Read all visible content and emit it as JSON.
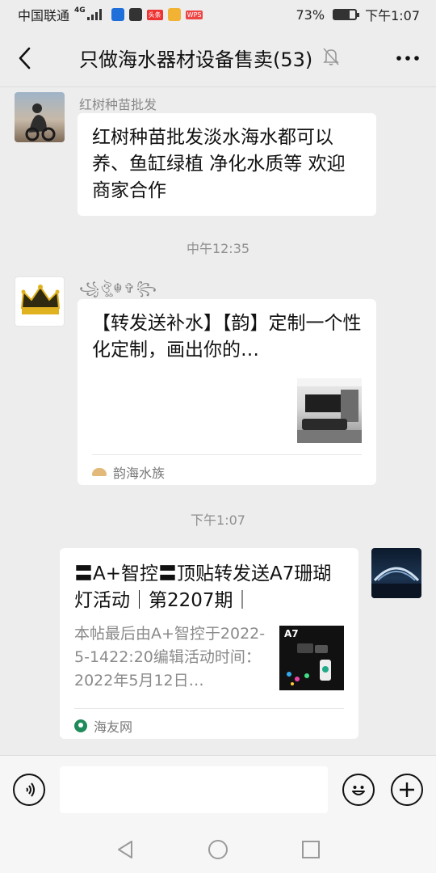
{
  "status_bar": {
    "carrier": "中国联通",
    "network": "4G",
    "app_badges": [
      "wechat-icon",
      "toutiao-label",
      "news-icon",
      "wps-label"
    ],
    "toutiao_label": "头条",
    "wps_label": "WPS",
    "battery_percent": "73%",
    "battery_level": 0.73,
    "time": "下午1:07"
  },
  "header": {
    "title": "只做海水器材设备售卖(53)",
    "muted": true
  },
  "messages": [
    {
      "sender": "红树种苗批发",
      "text": "红树种苗批发淡水海水都可以养、鱼缸绿植 净化水质等 欢迎商家合作"
    },
    {
      "time": "中午12:35"
    },
    {
      "sender": "꧁ঔৣ☬✞꧂",
      "card_title": "【转发送补水】【韵】定制一个性化定制，画出你的…",
      "source": "韵海水族"
    },
    {
      "time": "下午1:07"
    },
    {
      "self": true,
      "card_title": "〓A+智控〓顶贴转发送A7珊瑚灯活动｜第2207期｜",
      "card_desc": "本帖最后由A+智控于2022-5-1422:20编辑活动时间：2022年5月12日…",
      "thumb_label": "A7",
      "source": "海友网"
    }
  ],
  "input_bar": {
    "placeholder": ""
  },
  "colors": {
    "background": "#ededed",
    "bubble": "#ffffff",
    "muted_text": "#8a8a8a"
  }
}
